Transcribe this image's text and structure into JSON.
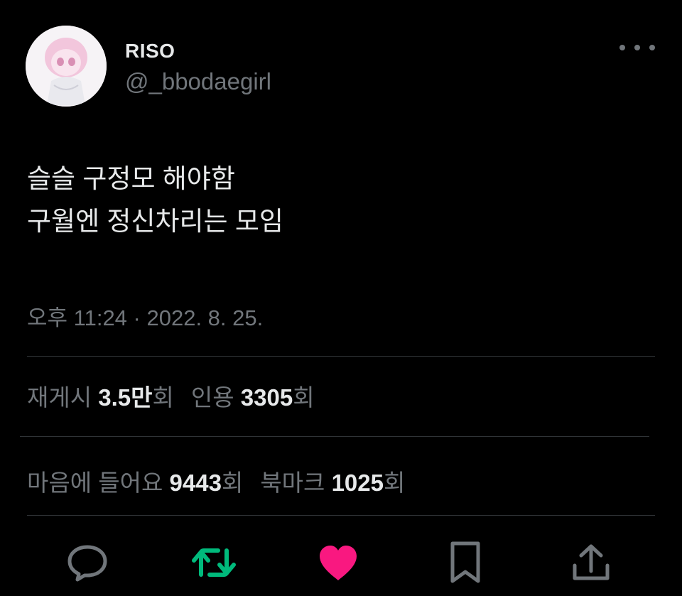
{
  "user": {
    "display_name": "RISO",
    "handle": "@_bbodaegirl"
  },
  "tweet": {
    "lines": [
      "슬슬 구정모 해야함",
      "구월엔 정신차리는 모임"
    ],
    "timestamp": "오후 11:24 · 2022. 8. 25."
  },
  "stats": {
    "retweets": {
      "label": "재게시",
      "value": "3.5만",
      "suffix": "회"
    },
    "quotes": {
      "label": "인용",
      "value": "3305",
      "suffix": "회"
    },
    "likes": {
      "label": "마음에 들어요",
      "value": "9443",
      "suffix": "회"
    },
    "bookmarks": {
      "label": "북마크",
      "value": "1025",
      "suffix": "회"
    }
  },
  "actions": [
    {
      "name": "reply-icon",
      "color": "#71767b"
    },
    {
      "name": "retweet-icon",
      "color": "#00ba7c"
    },
    {
      "name": "like-icon",
      "color": "#f91880"
    },
    {
      "name": "bookmark-icon",
      "color": "#71767b"
    },
    {
      "name": "share-icon",
      "color": "#71767b"
    }
  ]
}
